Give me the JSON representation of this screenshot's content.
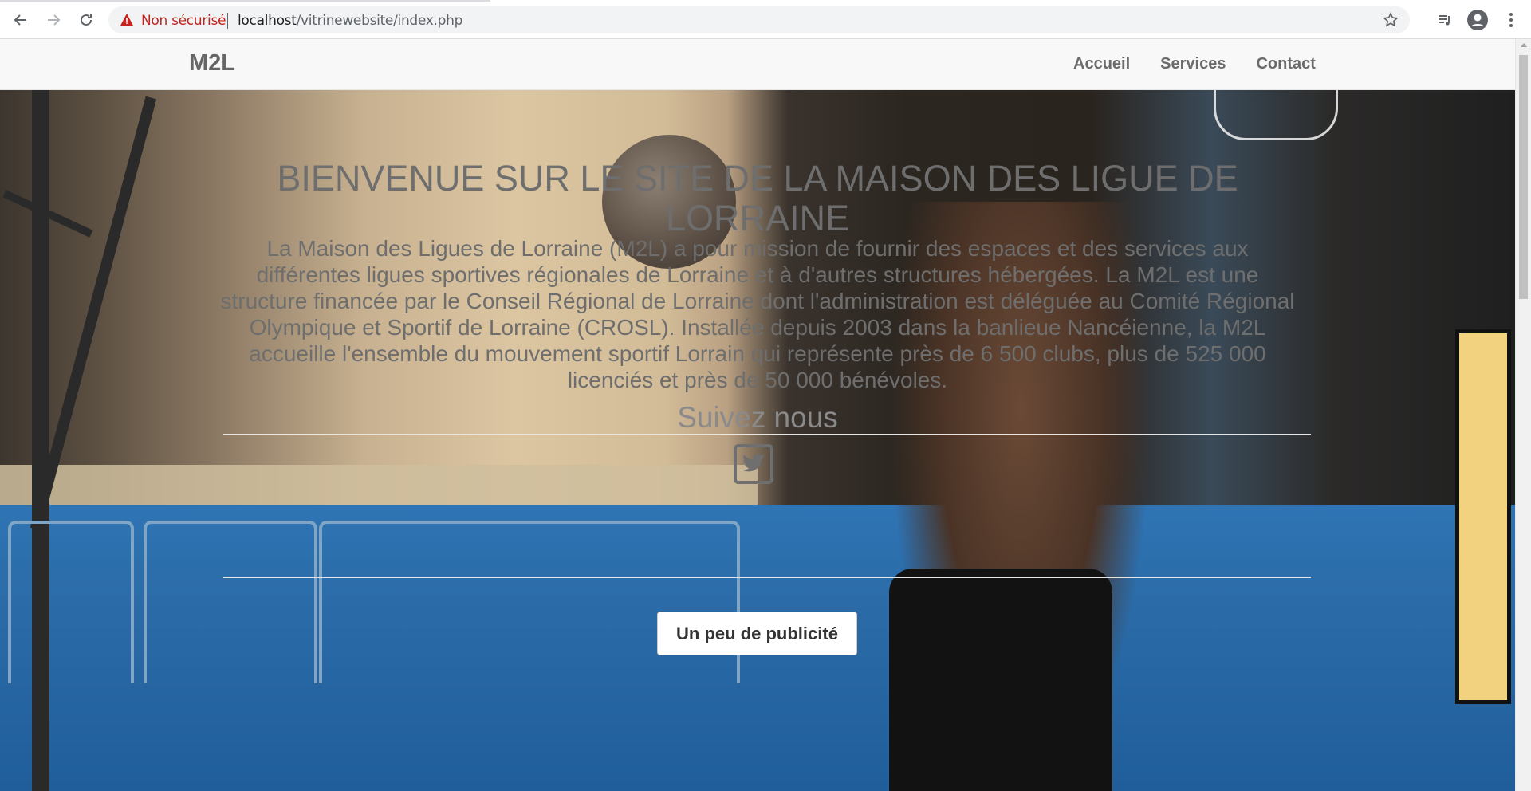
{
  "browser": {
    "security_label": "Non sécurisé",
    "url_host": "localhost",
    "url_path": "/vitrinewebsite/index.php"
  },
  "site": {
    "brand": "M2L",
    "nav": [
      {
        "label": "Accueil"
      },
      {
        "label": "Services"
      },
      {
        "label": "Contact"
      }
    ]
  },
  "hero": {
    "headline": "BIENVENUE SUR LE SITE DE LA MAISON DES LIGUE DE LORRAINE",
    "intro": "La Maison des Ligues de Lorraine (M2L) a pour mission de fournir des espaces et des services aux différentes ligues sportives régionales de Lorraine et à d'autres structures hébergées. La M2L est une structure financée par le Conseil Régional de Lorraine dont l'administration est déléguée au Comité Régional Olympique et Sportif de Lorraine (CROSL). Installée depuis 2003 dans la banlieue Nancéienne, la M2L accueille l'ensemble du mouvement sportif Lorrain qui représente près de 6 500 clubs, plus de 525 000 licenciés et près de 50 000 bénévoles.",
    "follow_title": "Suivez nous",
    "social_icon": "twitter-icon",
    "ad_button": "Un peu de publicité"
  },
  "colors": {
    "text_overlay": "#6e6e6e",
    "navbar_bg": "#f8f8f8",
    "insecure_red": "#c5221f"
  }
}
